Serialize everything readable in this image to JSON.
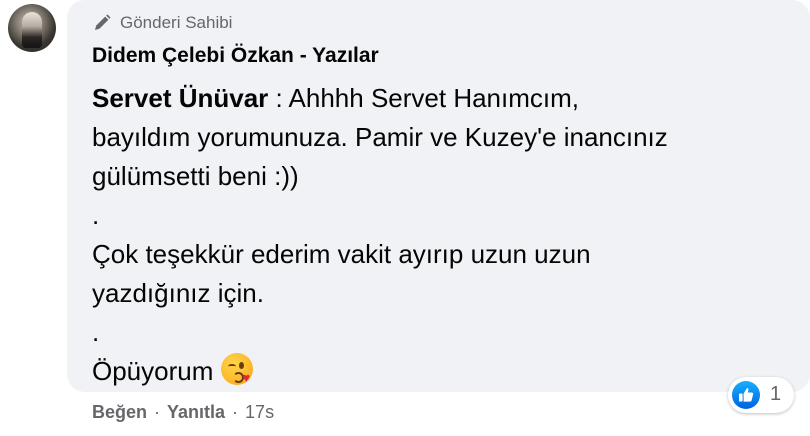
{
  "author_badge": {
    "icon": "pen-icon",
    "label": "Gönderi Sahibi"
  },
  "comment": {
    "author": "Didem Çelebi Özkan - Yazılar",
    "mention": "Servet Ünüvar",
    "lines": [
      " : Ahhhh Servet Hanımcım,",
      "bayıldım yorumunuza. Pamir ve Kuzey'e inancınız",
      "gülümsetti beni :))",
      ".",
      "Çok teşekkür ederim vakit ayırıp uzun uzun",
      "yazdığınız için.",
      ".",
      "Öpüyorum"
    ],
    "emoji": "face-blowing-a-kiss-emoji"
  },
  "actions": {
    "like_label": "Beğen",
    "separator": "·",
    "reply_label": "Yanıtla",
    "time": "17s"
  },
  "reactions": {
    "icon": "like-icon",
    "count": "1"
  },
  "colors": {
    "bubble_bg": "#f0f2f5",
    "secondary_text": "#65676b",
    "primary_text": "#050505",
    "like_blue": "#1877f2"
  }
}
